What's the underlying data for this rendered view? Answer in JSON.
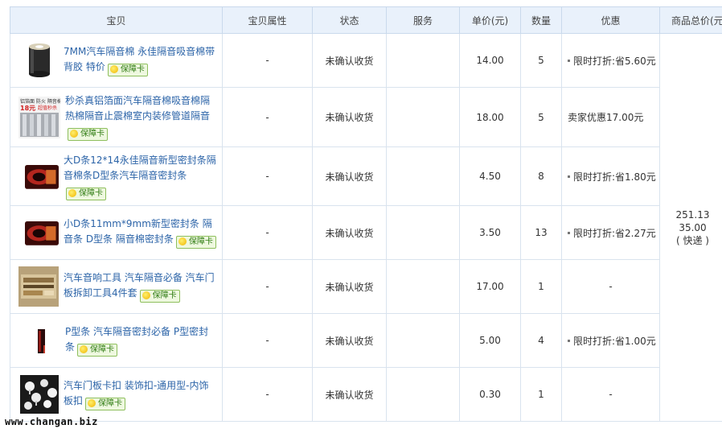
{
  "headers": {
    "item": "宝贝",
    "attributes": "宝贝属性",
    "status": "状态",
    "service": "服务",
    "unit_price": "单价(元)",
    "quantity": "数量",
    "discount": "优惠",
    "total": "商品总价(元"
  },
  "card_label": "保障卡",
  "items": [
    {
      "title": "7MM汽车隔音棉 永佳隔音吸音棉带背胶 特价",
      "attr": "-",
      "status": "未确认收货",
      "price": "14.00",
      "qty": "5",
      "discount": "限时打折:省5.60元",
      "discount_dot": true,
      "thumb_icon": "foam-roll-thumbnail"
    },
    {
      "title": "秒杀真铝箔面汽车隔音棉吸音棉隔热棉隔音止震棉室内装修管道隔音",
      "attr": "-",
      "status": "未确认收货",
      "price": "18.00",
      "qty": "5",
      "discount": "卖家优惠17.00元",
      "discount_dot": false,
      "thumb_icon": "foil-insulation-thumbnail"
    },
    {
      "title": "大D条12*14永佳隔音新型密封条隔音棉条D型条汽车隔音密封条",
      "attr": "-",
      "status": "未确认收货",
      "price": "4.50",
      "qty": "8",
      "discount": "限时打折:省1.80元",
      "discount_dot": true,
      "thumb_icon": "d-seal-strip-thumbnail"
    },
    {
      "title": "小D条11mm*9mm新型密封条 隔音条 D型条 隔音棉密封条",
      "attr": "-",
      "status": "未确认收货",
      "price": "3.50",
      "qty": "13",
      "discount": "限时打折:省2.27元",
      "discount_dot": true,
      "thumb_icon": "d-seal-strip-small-thumbnail"
    },
    {
      "title": "汽车音响工具 汽车隔音必备 汽车门板拆卸工具4件套",
      "attr": "-",
      "status": "未确认收货",
      "price": "17.00",
      "qty": "1",
      "discount": "-",
      "discount_dot": false,
      "thumb_icon": "tool-kit-thumbnail"
    },
    {
      "title": "P型条 汽车隔音密封必备 P型密封条",
      "attr": "-",
      "status": "未确认收货",
      "price": "5.00",
      "qty": "4",
      "discount": "限时打折:省1.00元",
      "discount_dot": true,
      "thumb_icon": "p-seal-strip-thumbnail"
    },
    {
      "title": "汽车门板卡扣 装饰扣-通用型-内饰板扣",
      "attr": "-",
      "status": "未确认收货",
      "price": "0.30",
      "qty": "1",
      "discount": "-",
      "discount_dot": false,
      "thumb_icon": "door-clips-thumbnail"
    }
  ],
  "order_total": {
    "amount": "251.13",
    "shipping": "35.00",
    "shipping_method": "( 快递 )"
  },
  "thumb_texts": {
    "foil_top": "铝箔面 防火 隔音棉",
    "foil_price": "18元",
    "foil_tag": "超值秒杀"
  },
  "watermark": "www.changan.biz",
  "colors": {
    "header_bg": "#e9f1fb",
    "link": "#2c64a8",
    "border": "#d9e3ee"
  }
}
